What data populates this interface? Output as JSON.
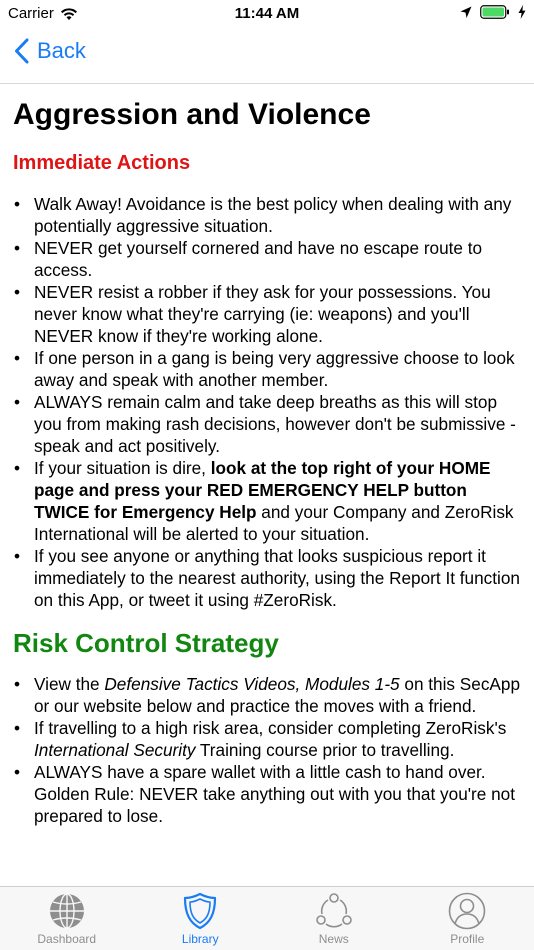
{
  "status_bar": {
    "carrier": "Carrier",
    "time": "11:44 AM"
  },
  "nav": {
    "back_label": "Back"
  },
  "page": {
    "title": "Aggression and Violence",
    "immediate_heading": "Immediate Actions",
    "immediate_items": [
      "Walk Away! Avoidance is the best policy when dealing with any potentially aggressive situation.",
      "NEVER get yourself cornered and have no escape route to access.",
      "NEVER resist a robber if they ask for your possessions. You never know what they're carrying (ie: weapons) and you'll NEVER know if they're working alone.",
      "If one person in a gang is being very aggressive choose to look away and speak with another member.",
      "ALWAYS remain calm and take deep breaths as this will stop you from making rash decisions, however don't be submissive - speak and act positively."
    ],
    "dire_item": {
      "pre": "If your situation is dire, ",
      "bold": "look at the top right of your HOME page and press your RED EMERGENCY HELP button TWICE for Emergency Help",
      "post": " and your Company and ZeroRisk International will be alerted to your situation."
    },
    "suspicious_item": "If you see anyone or anything that looks suspicious report it immediately to the nearest authority, using the Report It function on this App, or tweet it using #ZeroRisk.",
    "risk_heading": "Risk Control Strategy",
    "risk_item_1": {
      "pre": "View the ",
      "italic": "Defensive Tactics Videos, Modules 1-5",
      "post": " on this SecApp or our website below and practice the moves with a friend."
    },
    "risk_item_2": {
      "pre": "If travelling to a high risk area, consider completing ZeroRisk's ",
      "italic": "International Security",
      "post": " Training course prior to travelling."
    },
    "risk_item_3": "ALWAYS have a spare wallet with a little cash to hand over. Golden Rule: NEVER take anything out with you that you're not prepared to lose."
  },
  "tabs": [
    {
      "label": "Dashboard",
      "icon": "globe-icon"
    },
    {
      "label": "Library",
      "icon": "shield-icon"
    },
    {
      "label": "News",
      "icon": "share-icon"
    },
    {
      "label": "Profile",
      "icon": "person-icon"
    }
  ],
  "colors": {
    "accent": "#1a7cf5",
    "red_heading": "#e01414",
    "green_heading": "#118711",
    "battery": "#4cd964"
  }
}
